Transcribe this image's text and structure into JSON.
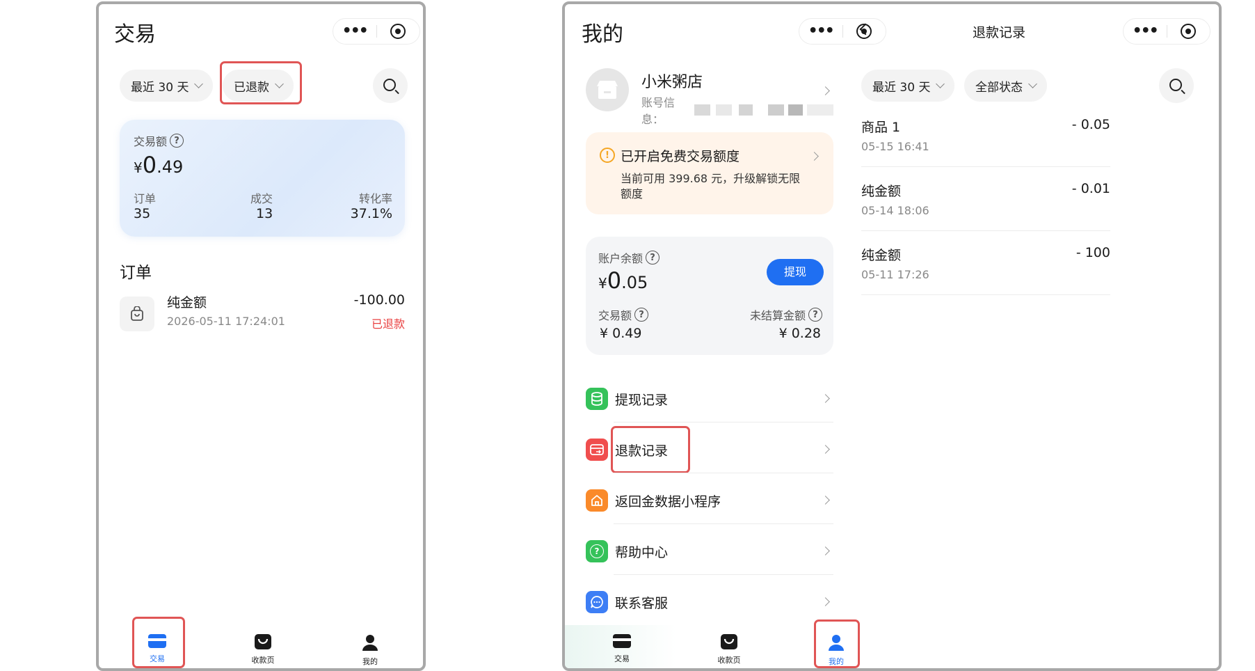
{
  "left_screen": {
    "title": "交易",
    "filters": {
      "range": "最近 30 天",
      "status": "已退款"
    },
    "summary": {
      "amount_label": "交易额",
      "amount_currency": "¥",
      "amount_int": "0",
      "amount_dec": ".49",
      "orders_label": "订单",
      "orders_value": "35",
      "deals_label": "成交",
      "deals_value": "13",
      "conversion_label": "转化率",
      "conversion_value": "37.1%"
    },
    "section_title": "订单",
    "order": {
      "name": "纯金额",
      "time": "2026-05-11 17:24:01",
      "amount": "-100.00",
      "status": "已退款"
    },
    "tabbar": {
      "trade": "交易",
      "collect": "收款页",
      "mine": "我的"
    }
  },
  "mine_screen": {
    "title": "我的",
    "profile": {
      "name": "小米粥店",
      "account_label": "账号信息："
    },
    "notice": {
      "title": "已开启免费交易额度",
      "body": "当前可用 399.68 元，升级解锁无限额度"
    },
    "balance": {
      "label": "账户余额",
      "currency": "¥",
      "int": "0",
      "dec": ".05",
      "withdraw_button": "提现",
      "trade_label": "交易额",
      "trade_value": "¥ 0.49",
      "unsettled_label": "未结算金额",
      "unsettled_value": "¥ 0.28"
    },
    "menu": [
      {
        "label": "提现记录",
        "icon": "database-icon",
        "color": "#35c25a"
      },
      {
        "label": "退款记录",
        "icon": "refund-card-icon",
        "color": "#f04e4e"
      },
      {
        "label": "返回金数据小程序",
        "icon": "home-icon",
        "color": "#fa8a2a"
      },
      {
        "label": "帮助中心",
        "icon": "help-icon",
        "color": "#35c25a"
      },
      {
        "label": "联系客服",
        "icon": "chat-icon",
        "color": "#3d7ef5"
      }
    ],
    "tabbar": {
      "trade": "交易",
      "collect": "收款页",
      "mine": "我的"
    }
  },
  "refund_screen": {
    "title": "退款记录",
    "filters": {
      "range": "最近 30 天",
      "status": "全部状态"
    },
    "items": [
      {
        "name": "商品 1",
        "time": "05-15 16:41",
        "amount": "- 0.05"
      },
      {
        "name": "纯金额",
        "time": "05-14 18:06",
        "amount": "- 0.01"
      },
      {
        "name": "纯金额",
        "time": "05-11 17:26",
        "amount": "- 100"
      }
    ]
  },
  "colors": {
    "accent": "#1f6ff2",
    "refund_red": "#e94040",
    "highlight": "#e05555"
  }
}
